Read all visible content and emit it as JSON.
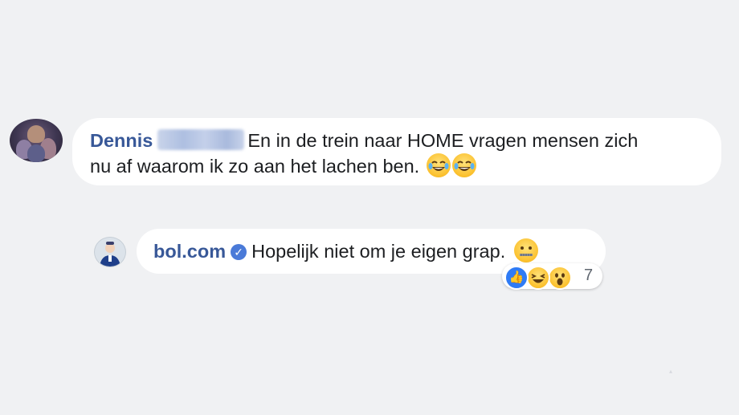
{
  "comments": [
    {
      "author": "Dennis",
      "avatar_icon": "profile-photo",
      "text_line_1": "En in de trein naar HOME vragen mensen zich",
      "text_line_2": "nu af waarom ik zo aan het lachen ben.",
      "emojis": [
        "tears-of-joy-emoji",
        "tears-of-joy-emoji"
      ]
    },
    {
      "author": "bol.com",
      "avatar_icon": "bol-logo",
      "verified_icon": "verified-badge-icon",
      "text": "Hopelijk niet om je eigen grap.",
      "emoji": "zipper-mouth-emoji",
      "reactions": {
        "icons": [
          "like-icon",
          "haha-icon",
          "wow-icon"
        ],
        "count": "7"
      }
    }
  ],
  "colors": {
    "background": "#f0f1f3",
    "bubble": "#ffffff",
    "author": "#385898",
    "like": "#2f7bf5"
  }
}
